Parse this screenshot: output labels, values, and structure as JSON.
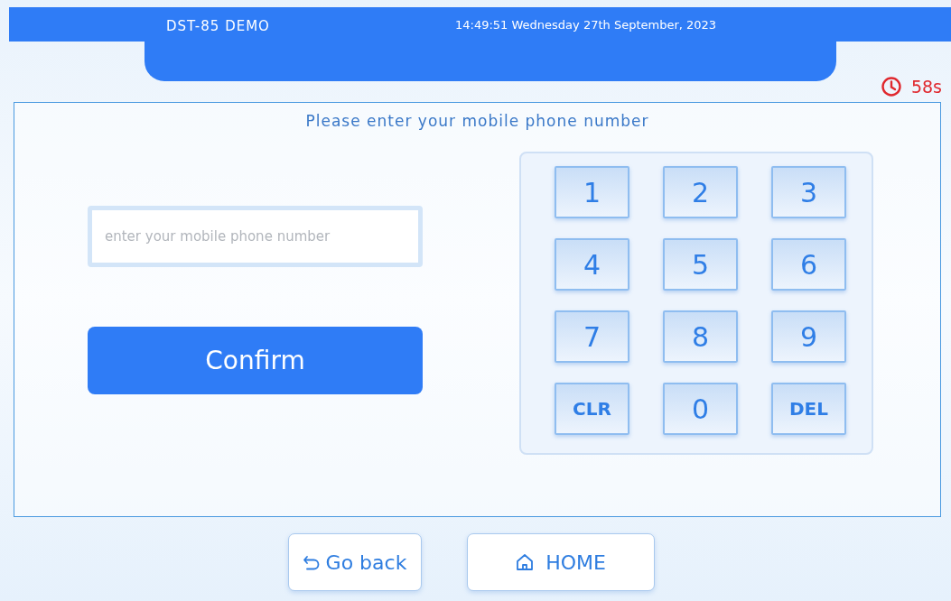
{
  "header": {
    "title": "DST-85 DEMO",
    "datetime": "14:49:51 Wednesday 27th September, 2023"
  },
  "timer": {
    "text": "58s"
  },
  "prompt": "Please enter your mobile phone number",
  "phone_field": {
    "placeholder": "enter your mobile phone number"
  },
  "confirm_button": "Confirm",
  "keypad": {
    "keys": [
      {
        "label": "1",
        "kind": "digit"
      },
      {
        "label": "2",
        "kind": "digit"
      },
      {
        "label": "3",
        "kind": "digit"
      },
      {
        "label": "4",
        "kind": "digit"
      },
      {
        "label": "5",
        "kind": "digit"
      },
      {
        "label": "6",
        "kind": "digit"
      },
      {
        "label": "7",
        "kind": "digit"
      },
      {
        "label": "8",
        "kind": "digit"
      },
      {
        "label": "9",
        "kind": "digit"
      },
      {
        "label": "CLR",
        "kind": "command"
      },
      {
        "label": "0",
        "kind": "digit"
      },
      {
        "label": "DEL",
        "kind": "command"
      }
    ]
  },
  "footer": {
    "back_button": "Go back",
    "home_button": "HOME"
  }
}
